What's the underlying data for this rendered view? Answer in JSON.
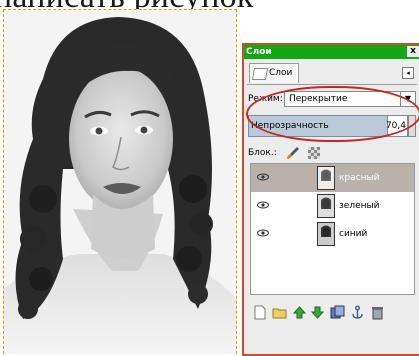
{
  "heading_text": "написать рисунок",
  "panel": {
    "title": "Слои",
    "close_glyph": "x",
    "tab_label": "Слои",
    "tab_menu_glyph": "◂",
    "mode_label": "Режим:",
    "mode_value": "Перекрытие",
    "mode_arrow": "▼",
    "opacity_label": "Непрозрачность",
    "opacity_value": "70,4",
    "lock_label": "Блок.:",
    "layers": [
      {
        "name": "красный",
        "visible": true,
        "selected": true
      },
      {
        "name": "зеленый",
        "visible": true,
        "selected": false
      },
      {
        "name": "синий",
        "visible": true,
        "selected": false
      }
    ],
    "bottom_buttons": [
      "new-layer-icon",
      "open-folder-icon",
      "raise-layer-icon",
      "lower-layer-icon",
      "duplicate-layer-icon",
      "anchor-icon",
      "delete-layer-icon"
    ]
  },
  "colors": {
    "title_bar": "#13a813",
    "selected_row": "#b8b2aa",
    "highlight_ellipse": "#c52626",
    "panel_border": "#cf4c28"
  }
}
